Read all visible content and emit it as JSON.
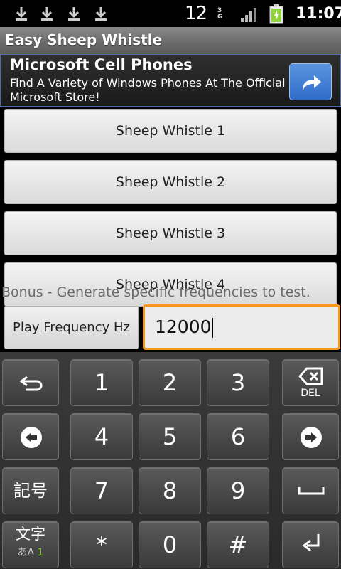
{
  "status_bar": {
    "notification_count": "12",
    "network": "3G",
    "time": "11:07"
  },
  "app": {
    "title": "Easy Sheep Whistle"
  },
  "ad": {
    "title": "Microsoft Cell Phones",
    "description_line1": "Find A Variety of Windows Phones At The Official",
    "description_line2": "Microsoft Store!"
  },
  "whistles": [
    {
      "label": "Sheep Whistle 1"
    },
    {
      "label": "Sheep Whistle 2"
    },
    {
      "label": "Sheep Whistle 3"
    },
    {
      "label": "Sheep Whistle 4"
    }
  ],
  "bonus_text": "Bonus - Generate specific frequencies to test.",
  "play_button_label": "Play Frequency Hz",
  "frequency_value": "12000",
  "keyboard": {
    "keys": {
      "k1": "1",
      "k2": "2",
      "k3": "3",
      "k4": "4",
      "k5": "5",
      "k6": "6",
      "k7": "7",
      "k8": "8",
      "k9": "9",
      "star": "*",
      "k0": "0",
      "hash": "#",
      "del_label": "DEL",
      "symbols_label": "記号",
      "mode_label": "文字",
      "mode_sub": "あA",
      "mode_sub_num": "1"
    }
  },
  "colors": {
    "focus_border": "#f39a1d",
    "ad_button": "#2f6cc8",
    "battery": "#8ed43a",
    "mode_sub_num": "#7fd13b"
  }
}
